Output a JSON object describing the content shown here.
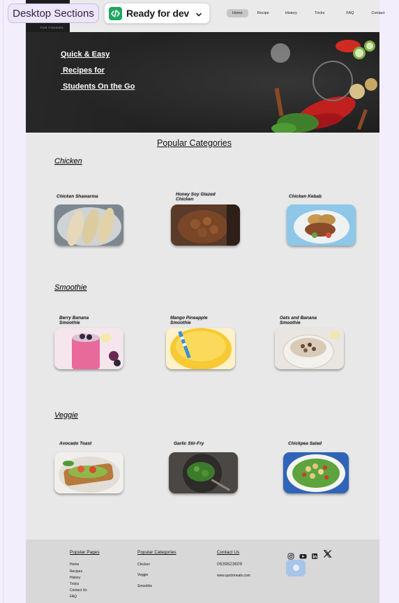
{
  "badges": {
    "sections_label": "Desktop Sections",
    "ready_label": "Ready for dev"
  },
  "nav": {
    "logo_caption": "FOR FOODIES",
    "links": [
      "Home",
      "Recipe",
      "History",
      "Tricks",
      "FAQ",
      "Contact"
    ],
    "active": "Home"
  },
  "hero": {
    "lines": [
      "Quick & Easy",
      " Recipes for",
      " Students On the Go"
    ]
  },
  "main": {
    "title": "Popular Categories",
    "categories": [
      {
        "name": "Chicken",
        "items": [
          "Chicken Shawarma",
          "Honey Soy Glazed Chicken",
          "Chicken Kebab"
        ]
      },
      {
        "name": "Smoothie",
        "items": [
          "Berry Banana Smoothie",
          "Mango Pineapple Smoothie",
          "Oats and Banana Smoothie"
        ]
      },
      {
        "name": "Veggie",
        "items": [
          "Avocado Toast",
          "Garlic Stir-Fry",
          "Chickpea Salad"
        ]
      }
    ]
  },
  "footer": {
    "col1": {
      "heading": "Popular Pages",
      "items": [
        "Home",
        "Recipes",
        "History",
        "Tricks",
        "Contact Us",
        "FAQ"
      ]
    },
    "col2": {
      "heading": "Popular Categories",
      "items": [
        "Chicken",
        "Veggie",
        "Smoothie"
      ]
    },
    "col3": {
      "heading": "Contact Us",
      "phone": "0639823609",
      "site": "www.quickmeals.com"
    },
    "social_icons": [
      "instagram-icon",
      "youtube-icon",
      "linkedin-icon",
      "x-icon"
    ]
  }
}
